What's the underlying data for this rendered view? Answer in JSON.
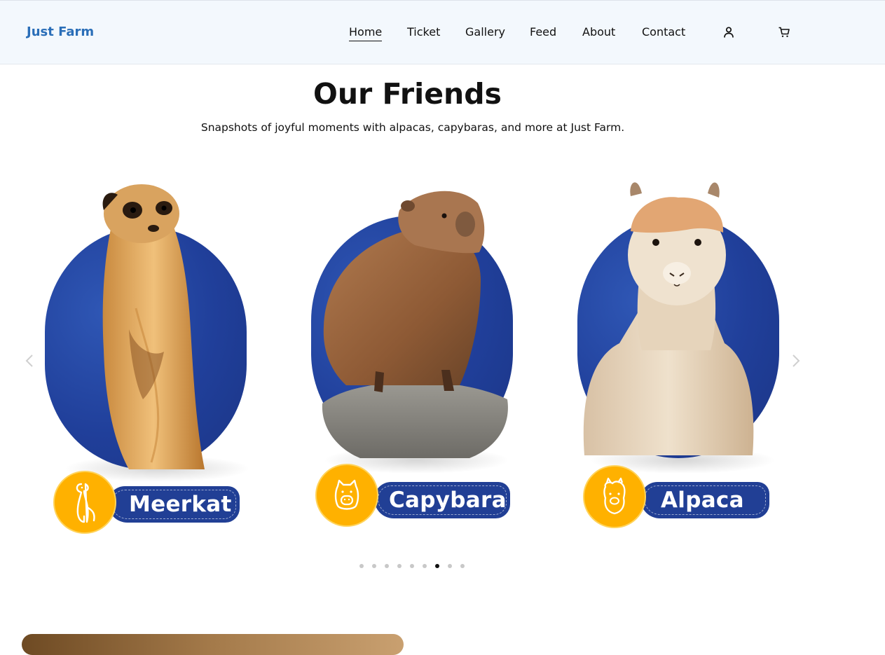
{
  "nav": {
    "brand": "Just Farm",
    "links": [
      {
        "label": "Home",
        "active": true
      },
      {
        "label": "Ticket",
        "active": false
      },
      {
        "label": "Gallery",
        "active": false
      },
      {
        "label": "Feed",
        "active": false
      },
      {
        "label": "About",
        "active": false
      },
      {
        "label": "Contact",
        "active": false
      }
    ],
    "icons": [
      "user-icon",
      "cart-icon"
    ]
  },
  "section": {
    "title": "Our Friends",
    "subtitle": "Snapshots of joyful moments with alpacas, capybaras, and more at Just Farm."
  },
  "carousel": {
    "cards": [
      {
        "name": "Meerkat",
        "icon": "meerkat-icon"
      },
      {
        "name": "Capybara",
        "icon": "capybara-icon"
      },
      {
        "name": "Alpaca",
        "icon": "alpaca-icon"
      }
    ],
    "prev_icon": "chevron-left-icon",
    "next_icon": "chevron-right-icon",
    "dot_count": 9,
    "active_dot": 7
  },
  "colors": {
    "brand": "#2a6eb8",
    "blob": "#203f9a",
    "badge": "#ffb100",
    "pill": "#213f95"
  }
}
